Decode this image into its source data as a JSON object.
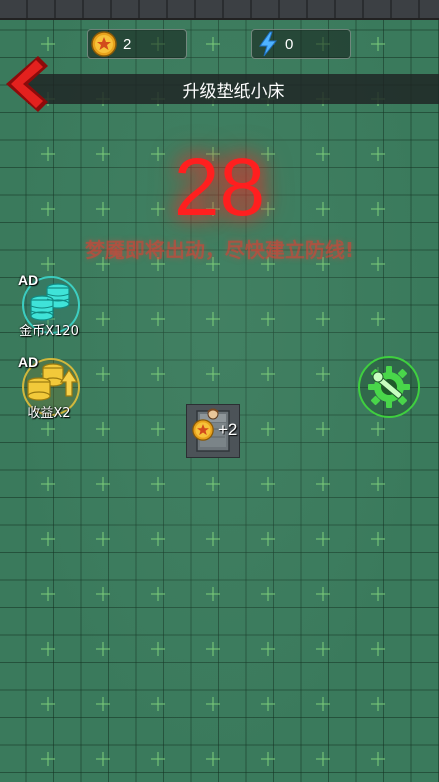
{
  "header": {
    "coins": {
      "icon": "coin-star-icon",
      "value": "2"
    },
    "energy": {
      "icon": "lightning-icon",
      "value": "0"
    }
  },
  "title_bar": {
    "title": "升级垫纸小床",
    "back_icon": "back-arrow-icon"
  },
  "countdown": {
    "value": "28",
    "color": "#ff1f1f"
  },
  "warning": {
    "text": "梦魇即将出动，尽快建立防线!"
  },
  "ad_buttons": [
    {
      "tag": "AD",
      "label": "金币X120",
      "icon": "coin-stack-icon",
      "color": "#3fe3d8"
    },
    {
      "tag": "AD",
      "label": "收益X2",
      "icon": "coin-upgrade-icon",
      "color": "#f2c93a"
    }
  ],
  "tool_button": {
    "icon": "wrench-gear-icon",
    "color": "#3fcf3f"
  },
  "bed": {
    "icon": "paper-bed-icon"
  },
  "income_popup": {
    "icon": "coin-star-icon",
    "text": "+2"
  }
}
